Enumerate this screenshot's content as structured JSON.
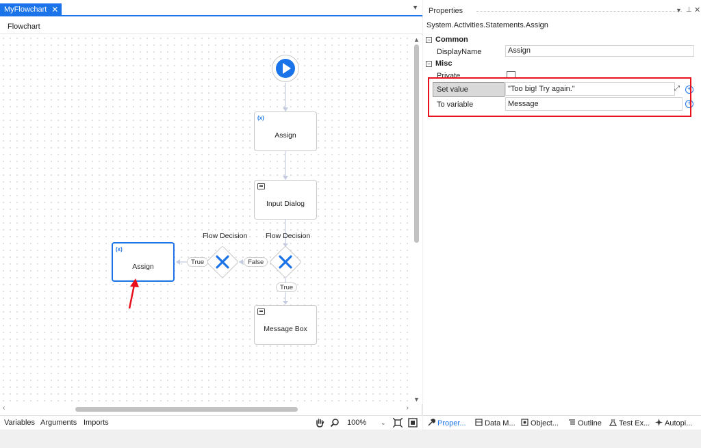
{
  "document_tab": {
    "title": "MyFlowchart",
    "close": "✕"
  },
  "breadcrumb": "Flowchart",
  "flowchart": {
    "start": "start",
    "nodes": {
      "assign_top": {
        "icon": "(x)",
        "label": "Assign"
      },
      "input_dialog": {
        "label": "Input Dialog"
      },
      "message_box": {
        "label": "Message Box"
      },
      "assign_left": {
        "icon": "(x)",
        "label": "Assign"
      }
    },
    "decisions": {
      "right": {
        "label": "Flow Decision",
        "false_label": "False",
        "true_label": "True"
      },
      "left": {
        "label": "Flow Decision",
        "true_label": "True"
      }
    }
  },
  "designer_footer": {
    "tabs": [
      "Variables",
      "Arguments",
      "Imports"
    ],
    "zoom": "100%"
  },
  "properties": {
    "title": "Properties",
    "type": "System.Activities.Statements.Assign",
    "categories": {
      "common": "Common",
      "misc": "Misc"
    },
    "rows": {
      "display_name": {
        "label": "DisplayName",
        "value": "Assign"
      },
      "private": {
        "label": "Private"
      },
      "set_value": {
        "label": "Set value",
        "value": "\"Too big! Try again.\""
      },
      "to_variable": {
        "label": "To variable",
        "value": "Message"
      }
    },
    "bottom_tabs": [
      "Proper...",
      "Data M...",
      "Object...",
      "Outline",
      "Test Ex...",
      "Autopi..."
    ]
  },
  "colors": {
    "accent": "#1a73e8",
    "highlight": "#e8101a"
  }
}
